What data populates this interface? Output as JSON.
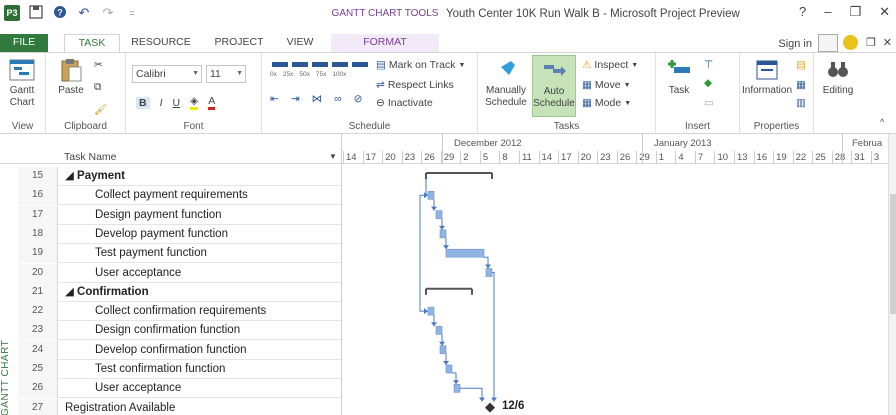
{
  "window": {
    "title": "Youth Center 10K Run Walk B - Microsoft Project Preview",
    "context_tab_group": "GANTT CHART TOOLS",
    "help": "?",
    "minimize": "–",
    "restore": "❐",
    "close": "✕"
  },
  "qat": {
    "app_icon_text": "P3",
    "undo": "↶",
    "redo": "↷"
  },
  "tabs": [
    "FILE",
    "TASK",
    "RESOURCE",
    "PROJECT",
    "VIEW",
    "FORMAT"
  ],
  "account": {
    "signin": "Sign in"
  },
  "ribbon": {
    "view": {
      "gantt_label": "Gantt\nChart",
      "group": "View"
    },
    "clipboard": {
      "paste": "Paste",
      "group": "Clipboard"
    },
    "font": {
      "family": "Calibri",
      "size": "11",
      "bold": "B",
      "italic": "I",
      "underline": "U",
      "group": "Font"
    },
    "schedule": {
      "pct_labels": [
        "0x",
        "25x",
        "50x",
        "75x",
        "100x"
      ],
      "mark_on_track": "Mark on Track",
      "respect_links": "Respect Links",
      "inactivate": "Inactivate",
      "group": "Schedule"
    },
    "tasks": {
      "manually": "Manually\nSchedule",
      "auto": "Auto\nSchedule",
      "inspect": "Inspect",
      "move": "Move",
      "mode": "Mode",
      "group": "Tasks"
    },
    "insert": {
      "task": "Task",
      "group": "Insert"
    },
    "properties": {
      "information": "Information",
      "group": "Properties"
    },
    "editing": {
      "label": "Editing"
    }
  },
  "grid": {
    "column_header": "Task Name",
    "side_label": "GANTT CHART",
    "rows": [
      {
        "id": "15",
        "name": "◢ Payment",
        "summary": true,
        "indent": 1
      },
      {
        "id": "16",
        "name": "Collect payment requirements",
        "summary": false,
        "indent": 2
      },
      {
        "id": "17",
        "name": "Design payment function",
        "summary": false,
        "indent": 2
      },
      {
        "id": "18",
        "name": "Develop payment function",
        "summary": false,
        "indent": 2
      },
      {
        "id": "19",
        "name": "Test payment function",
        "summary": false,
        "indent": 2
      },
      {
        "id": "20",
        "name": "User acceptance",
        "summary": false,
        "indent": 2
      },
      {
        "id": "21",
        "name": "◢ Confirmation",
        "summary": true,
        "indent": 1
      },
      {
        "id": "22",
        "name": "Collect confirmation requirements",
        "summary": false,
        "indent": 2
      },
      {
        "id": "23",
        "name": "Design confirmation function",
        "summary": false,
        "indent": 2
      },
      {
        "id": "24",
        "name": "Develop confirmation function",
        "summary": false,
        "indent": 2
      },
      {
        "id": "25",
        "name": "Test confirmation function",
        "summary": false,
        "indent": 2
      },
      {
        "id": "26",
        "name": "User acceptance",
        "summary": false,
        "indent": 2
      },
      {
        "id": "27",
        "name": "Registration Available",
        "summary": false,
        "indent": 1
      }
    ]
  },
  "timescale": {
    "months": [
      "December 2012",
      "January 2013",
      "Februa"
    ],
    "days": [
      "14",
      "17",
      "20",
      "23",
      "26",
      "29",
      "2",
      "5",
      "8",
      "11",
      "14",
      "17",
      "20",
      "23",
      "26",
      "29",
      "1",
      "4",
      "7",
      "10",
      "13",
      "16",
      "19",
      "22",
      "25",
      "28",
      "31",
      "3"
    ]
  },
  "milestone": {
    "label": "12/6"
  },
  "colors": {
    "accent": "#2f7a3c",
    "bar": "#8fb4e3",
    "bar_border": "#6d95cc",
    "summary": "#555555",
    "link": "#4a78c2",
    "format": "#7a3e97"
  }
}
